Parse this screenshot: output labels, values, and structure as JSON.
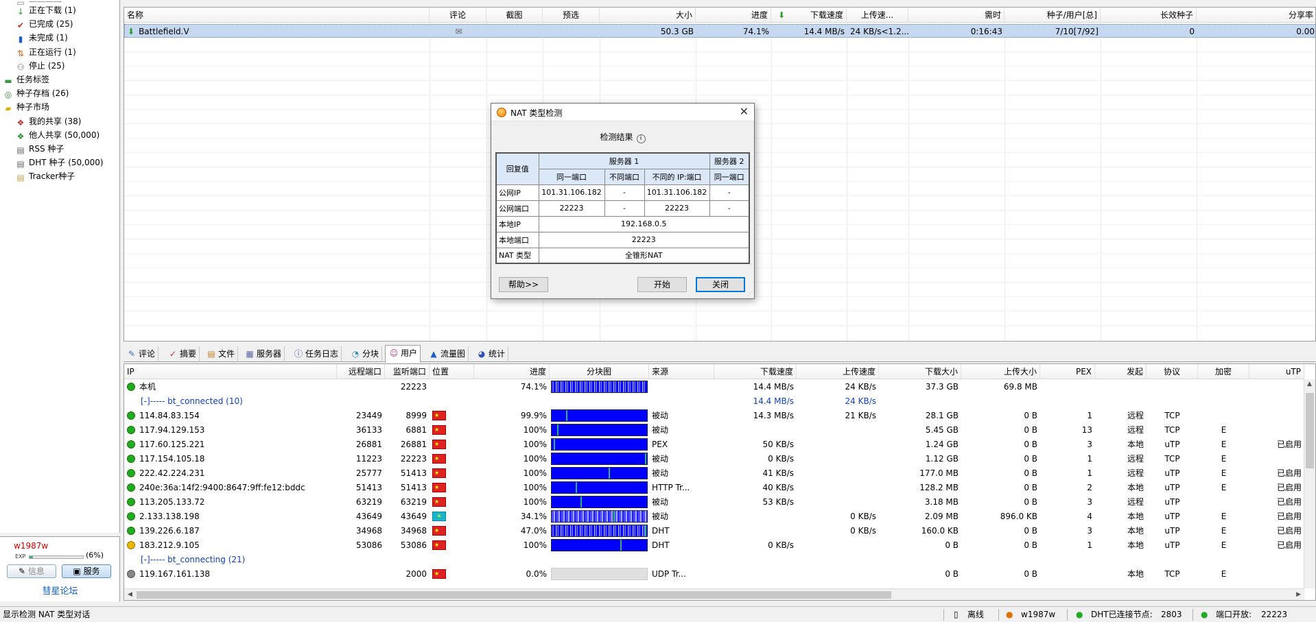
{
  "sidebar": {
    "items": [
      {
        "label": "正在下载 (1)",
        "icon": "↓",
        "color": "#2a9a2a"
      },
      {
        "label": "已完成 (25)",
        "icon": "✔",
        "color": "#d03020"
      },
      {
        "label": "未完成 (1)",
        "icon": "▮",
        "color": "#2060c0"
      },
      {
        "label": "正在运行 (1)",
        "icon": "⇅",
        "color": "#d06010"
      },
      {
        "label": "停止 (25)",
        "icon": "⚇",
        "color": "#666"
      },
      {
        "label": "任务标签",
        "icon": "▬",
        "color": "#3a9a3a"
      },
      {
        "label": "种子存档 (26)",
        "icon": "◎",
        "color": "#3a7a3a"
      },
      {
        "label": "种子市场",
        "icon": "▰",
        "color": "#e0b000"
      },
      {
        "label": "我的共享 (38)",
        "icon": "❖",
        "color": "#c03030"
      },
      {
        "label": "他人共享 (50,000)",
        "icon": "❖",
        "color": "#2a8a2a"
      },
      {
        "label": "RSS 种子",
        "icon": "▤",
        "color": "#666"
      },
      {
        "label": "DHT 种子 (50,000)",
        "icon": "▤",
        "color": "#666"
      },
      {
        "label": "Tracker种子",
        "icon": "▤",
        "color": "#c0a040"
      }
    ]
  },
  "user": {
    "name": "w1987w",
    "exp_label": "EXP",
    "exp_pct": "(6%)",
    "exp_fill": 0.06,
    "btn_info": "信息",
    "btn_service": "服务",
    "forum": "彗星论坛"
  },
  "toptable": {
    "headers": [
      "名称",
      "评论",
      "截图",
      "预选",
      "大小",
      "进度",
      "下载速度",
      "上传速...",
      "需时",
      "种子/用户[总]",
      "长效种子",
      "分享率"
    ],
    "row": {
      "name": "Battlefield.V",
      "comment_icon": "✉",
      "size": "50.3 GB",
      "progress": "74.1%",
      "down": "14.4 MB/s",
      "up": "24 KB/s<1.2...",
      "eta": "0:16:43",
      "seeds": "7/10[7/92]",
      "longseeds": "0",
      "ratio": "0.00"
    }
  },
  "tabs": [
    {
      "label": "评论",
      "icon": "✎"
    },
    {
      "label": "摘要",
      "icon": "✓"
    },
    {
      "label": "文件",
      "icon": "▤"
    },
    {
      "label": "服务器",
      "icon": "▦"
    },
    {
      "label": "任务日志",
      "icon": "ⓘ"
    },
    {
      "label": "分块",
      "icon": "◔"
    },
    {
      "label": "用户",
      "icon": "☺"
    },
    {
      "label": "流量图",
      "icon": "▲"
    },
    {
      "label": "统计",
      "icon": "◕"
    }
  ],
  "peers": {
    "headers": [
      "IP",
      "远程端口",
      "监听端口",
      "位置",
      "进度",
      "分块图",
      "来源",
      "下载速度",
      "上传速度",
      "下载大小",
      "上传大小",
      "PEX",
      "发起",
      "协议",
      "加密",
      "uTP"
    ],
    "local": {
      "ip": "本机",
      "listen": "22223",
      "progress": "74.1%",
      "down": "14.4 MB/s",
      "up": "24 KB/s",
      "dlsize": "37.3 GB",
      "ulsize": "69.8 MB"
    },
    "group1": {
      "label": "[-]----- bt_connected (10)",
      "down": "14.4 MB/s",
      "up": "24 KB/s"
    },
    "rows": [
      {
        "ip": "114.84.83.154",
        "rport": "23449",
        "lport": "8999",
        "flag": "cn",
        "progress": "99.9%",
        "bar": "full",
        "src": "被动",
        "down": "14.3 MB/s",
        "up": "21 KB/s",
        "dlsize": "28.1 GB",
        "ulsize": "0 B",
        "pex": "1",
        "init": "远程",
        "proto": "TCP",
        "enc": "",
        "utp": "",
        "mood": "ok"
      },
      {
        "ip": "117.94.129.153",
        "rport": "36133",
        "lport": "6881",
        "flag": "cn",
        "progress": "100%",
        "bar": "full",
        "src": "被动",
        "down": "",
        "up": "",
        "dlsize": "5.45 GB",
        "ulsize": "0 B",
        "pex": "13",
        "init": "远程",
        "proto": "TCP",
        "enc": "E",
        "utp": "",
        "mood": "ok"
      },
      {
        "ip": "117.60.125.221",
        "rport": "26881",
        "lport": "26881",
        "flag": "cn",
        "progress": "100%",
        "bar": "full",
        "src": "PEX",
        "down": "50 KB/s",
        "up": "",
        "dlsize": "1.24 GB",
        "ulsize": "0 B",
        "pex": "3",
        "init": "本地",
        "proto": "uTP",
        "enc": "E",
        "utp": "已启用",
        "mood": "ok"
      },
      {
        "ip": "117.154.105.18",
        "rport": "11223",
        "lport": "22223",
        "flag": "cn",
        "progress": "100%",
        "bar": "full",
        "src": "被动",
        "down": "0 KB/s",
        "up": "",
        "dlsize": "1.12 GB",
        "ulsize": "0 B",
        "pex": "1",
        "init": "远程",
        "proto": "TCP",
        "enc": "E",
        "utp": "",
        "mood": "ok"
      },
      {
        "ip": "222.42.224.231",
        "rport": "25777",
        "lport": "51413",
        "flag": "cn",
        "progress": "100%",
        "bar": "full",
        "src": "被动",
        "down": "41 KB/s",
        "up": "",
        "dlsize": "177.0 MB",
        "ulsize": "0 B",
        "pex": "1",
        "init": "远程",
        "proto": "uTP",
        "enc": "E",
        "utp": "已启用",
        "mood": "ok"
      },
      {
        "ip": "240e:36a:14f2:9400:8647:9ff:fe12:bddc",
        "rport": "51413",
        "lport": "51413",
        "flag": "cn",
        "progress": "100%",
        "bar": "full",
        "src": "HTTP Tr...",
        "down": "40 KB/s",
        "up": "",
        "dlsize": "128.2 MB",
        "ulsize": "0 B",
        "pex": "2",
        "init": "本地",
        "proto": "uTP",
        "enc": "E",
        "utp": "已启用",
        "mood": "ok"
      },
      {
        "ip": "113.205.133.72",
        "rport": "63219",
        "lport": "63219",
        "flag": "cn",
        "progress": "100%",
        "bar": "full",
        "src": "被动",
        "down": "53 KB/s",
        "up": "",
        "dlsize": "3.18 MB",
        "ulsize": "0 B",
        "pex": "3",
        "init": "远程",
        "proto": "uTP",
        "enc": "",
        "utp": "已启用",
        "mood": "ok"
      },
      {
        "ip": "2.133.138.198",
        "rport": "43649",
        "lport": "43649",
        "flag": "kz",
        "progress": "34.1%",
        "bar": "mix",
        "src": "被动",
        "down": "",
        "up": "0 KB/s",
        "dlsize": "2.09 MB",
        "ulsize": "896.0 KB",
        "pex": "4",
        "init": "本地",
        "proto": "uTP",
        "enc": "E",
        "utp": "已启用",
        "mood": "ok"
      },
      {
        "ip": "139.226.6.187",
        "rport": "34968",
        "lport": "34968",
        "flag": "cn",
        "progress": "47.0%",
        "bar": "mix2",
        "src": "DHT",
        "down": "",
        "up": "0 KB/s",
        "dlsize": "160.0 KB",
        "ulsize": "0 B",
        "pex": "3",
        "init": "本地",
        "proto": "uTP",
        "enc": "E",
        "utp": "已启用",
        "mood": "ok"
      },
      {
        "ip": "183.212.9.105",
        "rport": "53086",
        "lport": "53086",
        "flag": "cn",
        "progress": "100%",
        "bar": "full",
        "src": "DHT",
        "down": "0 KB/s",
        "up": "",
        "dlsize": "0 B",
        "ulsize": "0 B",
        "pex": "1",
        "init": "本地",
        "proto": "uTP",
        "enc": "E",
        "utp": "已启用",
        "mood": "sad"
      }
    ],
    "group2": {
      "label": "[-]----- bt_connecting (21)"
    },
    "last": {
      "ip": "119.167.161.138",
      "lport": "2000",
      "progress": "0.0%",
      "src": "UDP Tr...",
      "dlsize": "0 B",
      "ulsize": "0 B",
      "init": "本地",
      "proto": "TCP",
      "enc": "E"
    }
  },
  "status": {
    "left": "显示检测 NAT 类型对话",
    "offline": "离线",
    "user": "w1987w",
    "dht": "DHT已连接节点:",
    "dht_nodes": "2803",
    "port": "端口开放:",
    "port_num": "22223"
  },
  "dialog": {
    "title": "NAT 类型检测",
    "heading": "检测结果",
    "reply": "回复值",
    "server1": "服务器 1",
    "server2": "服务器 2",
    "same_port": "同一端口",
    "diff_port": "不同端口",
    "diff_ip_port": "不同的 IP:端口",
    "same_port2": "同一端口",
    "public_ip_label": "公网IP",
    "public_ip": "101.31.106.182",
    "public_ip_dash": "-",
    "public_ip2": "101.31.106.182",
    "public_ip_dash2": "-",
    "public_port_label": "公网端口",
    "public_port": "22223",
    "public_port_dash": "-",
    "public_port2": "22223",
    "public_port_dash2": "-",
    "local_ip_label": "本地IP",
    "local_ip": "192.168.0.5",
    "local_port_label": "本地端口",
    "local_port": "22223",
    "nat_type_label": "NAT 类型",
    "nat_type": "全锥形NAT",
    "btn_help": "帮助>>",
    "btn_start": "开始",
    "btn_close": "关闭"
  }
}
